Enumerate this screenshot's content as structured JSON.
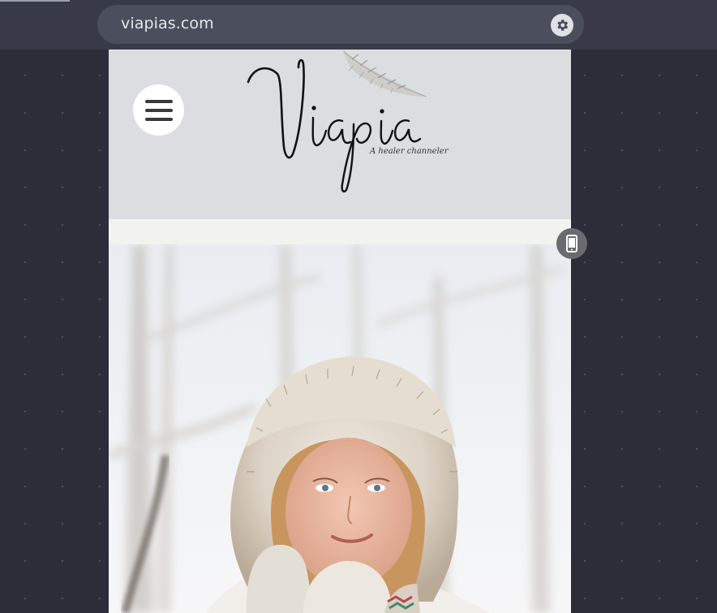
{
  "browser": {
    "url": "viapias.com",
    "settings_icon": "gear-icon"
  },
  "site": {
    "logo_text": "Viapia",
    "tagline": "A healer channeler",
    "menu_icon": "hamburger-icon"
  },
  "hero": {
    "image": "woman-in-fur-hat-winter-photo"
  },
  "device_toggle": {
    "icon": "mobile-phone-icon"
  },
  "colors": {
    "background": "#2b2e38",
    "topbar": "#383b47",
    "urlbar": "#4b4e5b",
    "header": "#dadee0"
  }
}
